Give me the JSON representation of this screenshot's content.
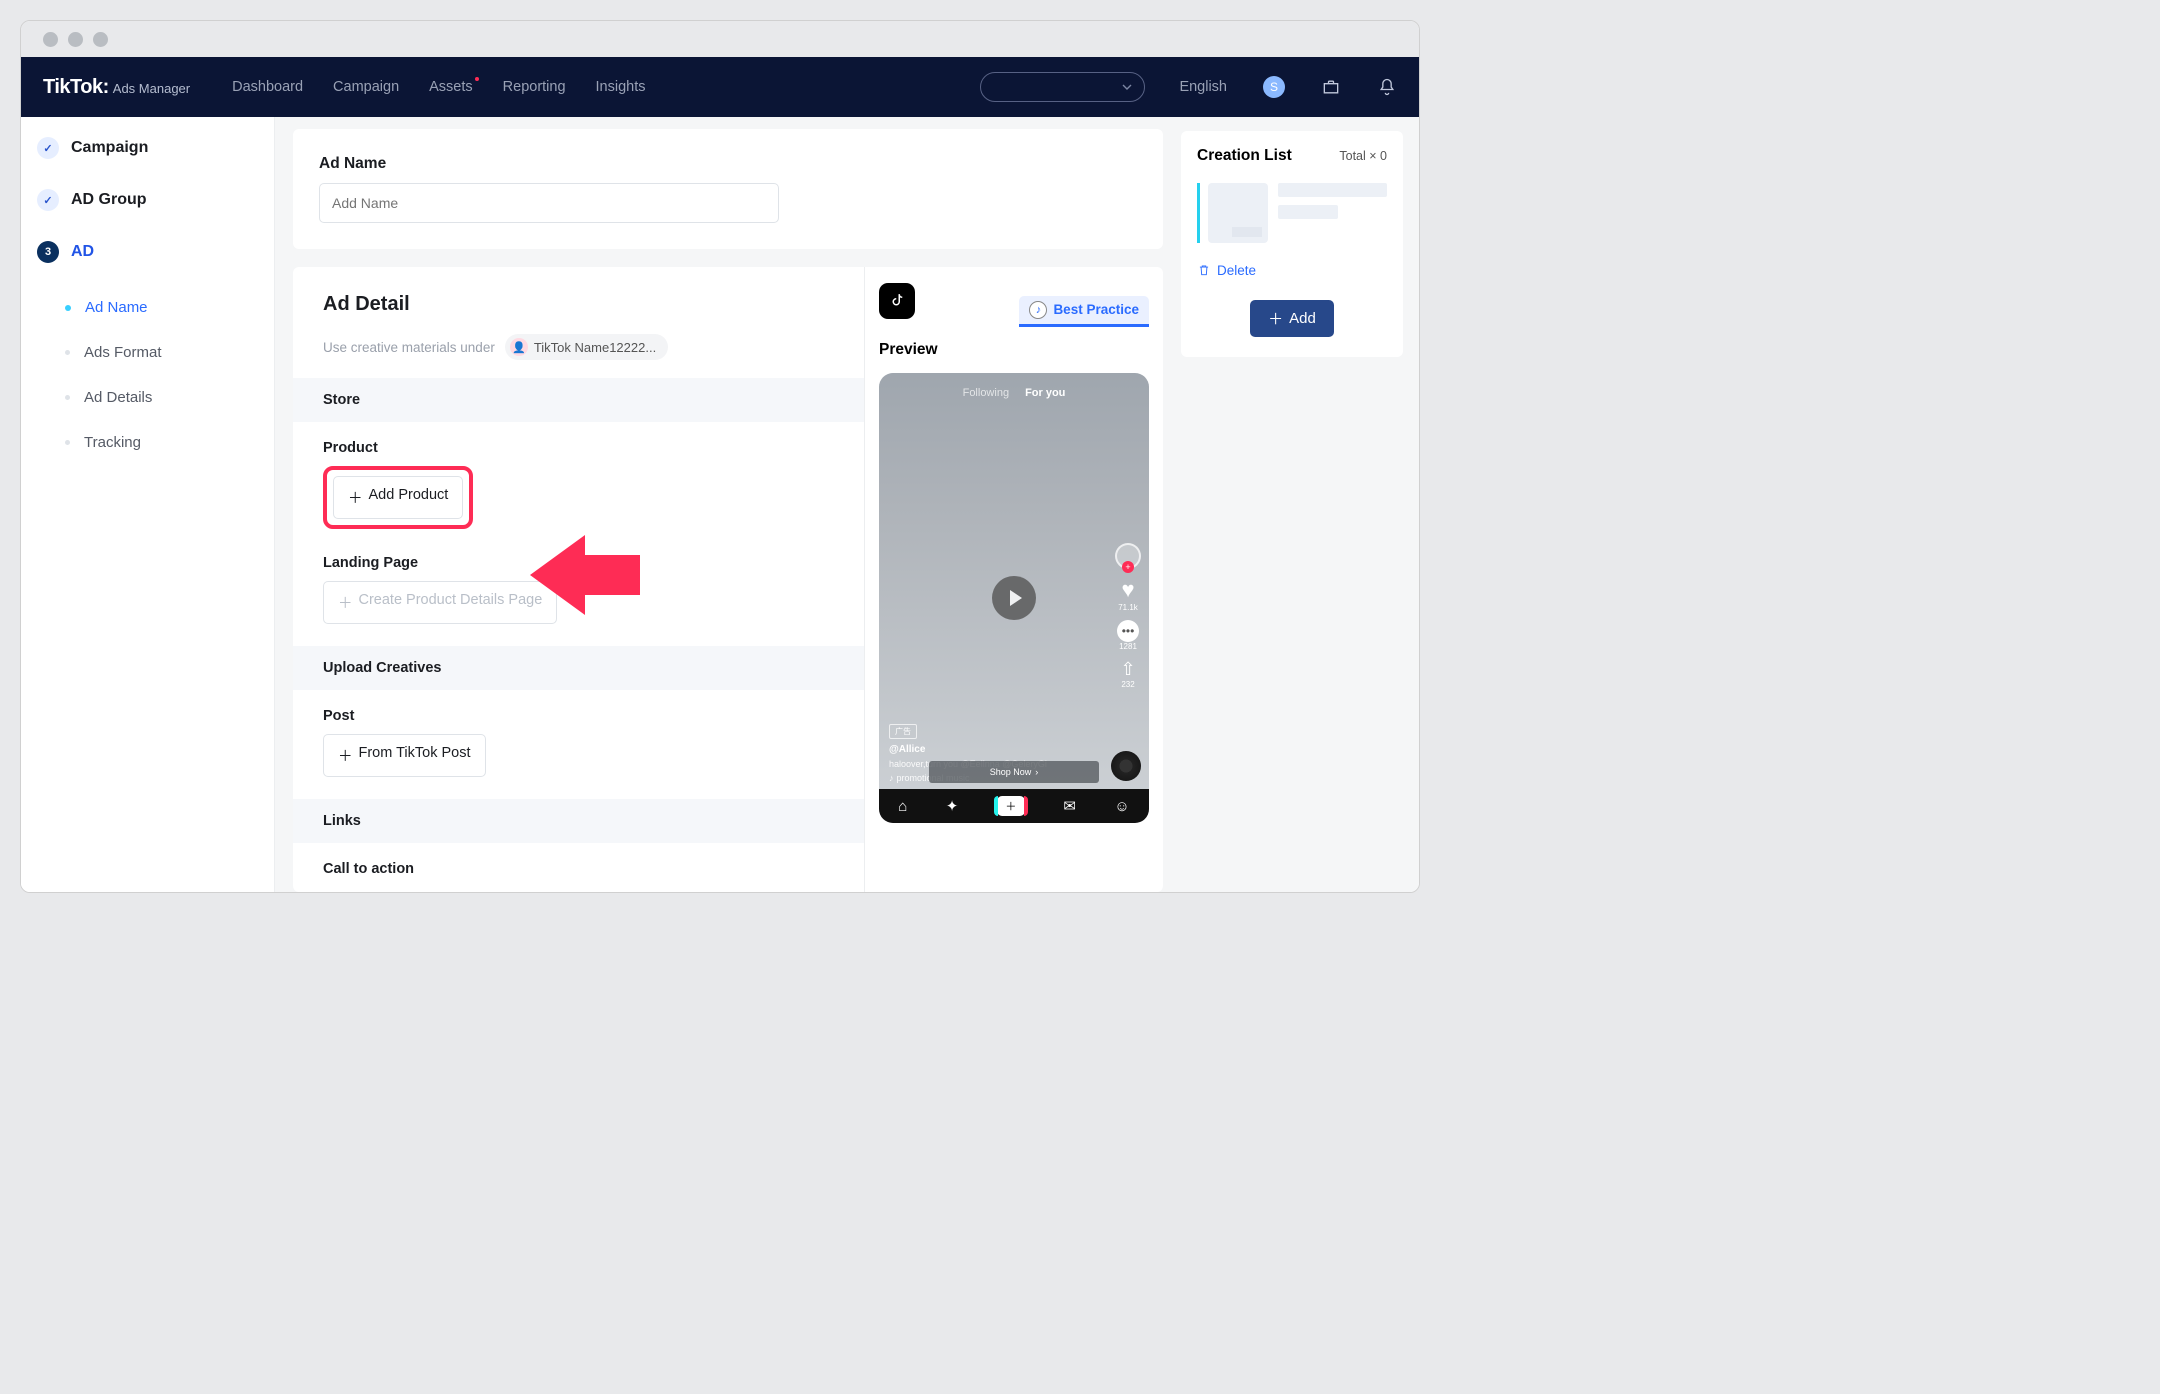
{
  "brand": {
    "logo": "TikTok:",
    "sub": "Ads Manager"
  },
  "nav": {
    "items": [
      {
        "label": "Dashboard"
      },
      {
        "label": "Campaign"
      },
      {
        "label": "Assets",
        "dot": true
      },
      {
        "label": "Reporting"
      },
      {
        "label": "Insights"
      }
    ],
    "language": "English",
    "avatar_letter": "S"
  },
  "sidebar": {
    "steps": [
      {
        "label": "Campaign",
        "done": true
      },
      {
        "label": "AD Group",
        "done": true
      },
      {
        "label": "AD",
        "num": "3",
        "active": true
      }
    ],
    "substeps": [
      {
        "label": "Ad Name",
        "active": true
      },
      {
        "label": "Ads Format"
      },
      {
        "label": "Ad Details"
      },
      {
        "label": "Tracking"
      }
    ]
  },
  "ad_name": {
    "title": "Ad Name",
    "placeholder": "Add Name"
  },
  "detail": {
    "title": "Ad Detail",
    "subtitle": "Use creative materials under",
    "identity": "TikTok Name12222...",
    "store_heading": "Store",
    "product_label": "Product",
    "add_product": "Add Product",
    "landing_label": "Landing Page",
    "create_landing": "Create Product Details Page",
    "upload_heading": "Upload Creatives",
    "post_label": "Post",
    "from_post": "From TikTok Post",
    "links_heading": "Links",
    "cta_heading": "Call to action"
  },
  "preview": {
    "best_practice": "Best Practice",
    "label": "Preview",
    "following": "Following",
    "foryou": "For you",
    "adTag": "广告",
    "user": "@Allice",
    "caption": "haloover,turn you @Eellnna @GeleryGi",
    "music": "promotional music",
    "shop": "Shop Now",
    "likes": "71.1k",
    "comments": "1281",
    "shares": "232"
  },
  "creation": {
    "title": "Creation List",
    "total_label": "Total",
    "total_value": "× 0",
    "delete": "Delete",
    "add": "Add"
  }
}
